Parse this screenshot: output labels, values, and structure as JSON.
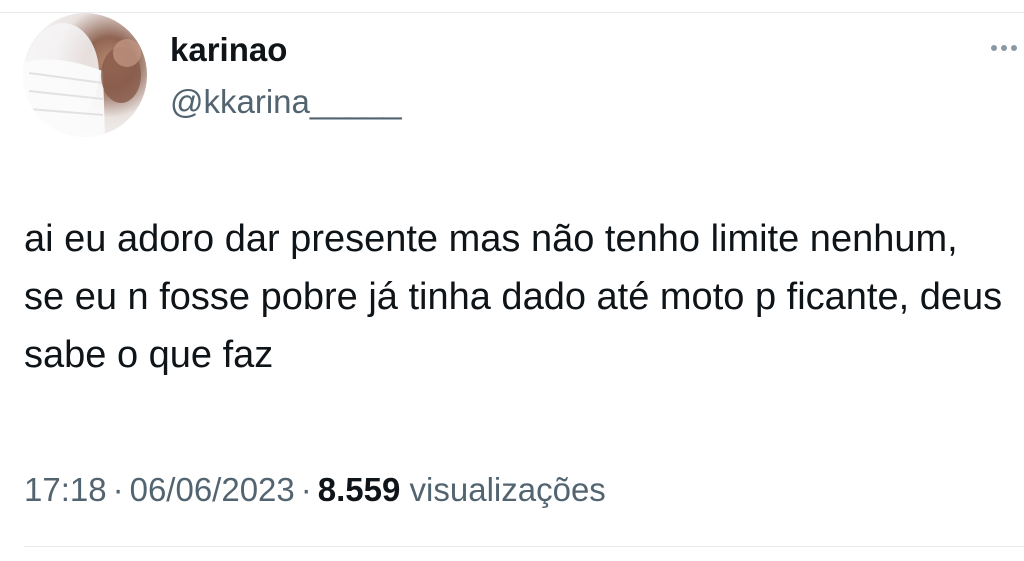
{
  "tweet": {
    "author_name": "karinao",
    "author_handle": "@kkarina_____",
    "more_icon": "more-horizontal-icon",
    "text": "ai eu adoro dar presente mas não tenho limite nenhum, se eu n fosse pobre já tinha dado até moto p ficante, deus sabe o que faz",
    "time": "17:18",
    "separator": "·",
    "date": "06/06/2023",
    "views_count": "8.559",
    "views_label": "visualizações"
  }
}
